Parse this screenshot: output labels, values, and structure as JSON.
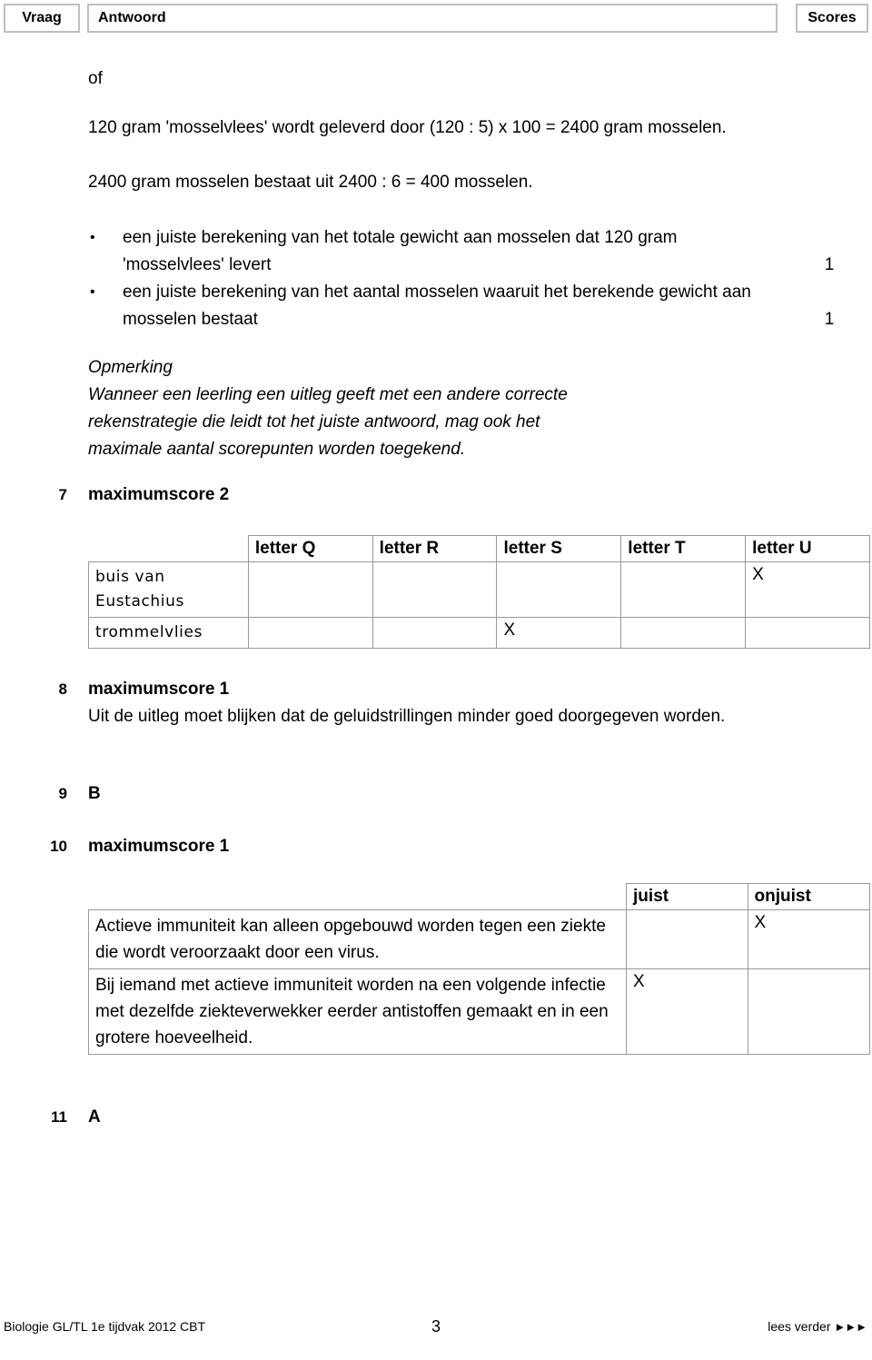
{
  "header": {
    "vraag": "Vraag",
    "antwoord": "Antwoord",
    "scores": "Scores"
  },
  "continued_answer": {
    "of_label": "of",
    "line1": "120 gram 'mosselvlees' wordt geleverd door (120 : 5) x 100 = 2400 gram mosselen.",
    "line2": "2400 gram mosselen bestaat uit 2400 : 6 = 400 mosselen.",
    "bullets": [
      {
        "text": "een juiste berekening van het totale gewicht aan mosselen dat 120 gram 'mosselvlees' levert",
        "score": "1"
      },
      {
        "text": "een juiste berekening van het aantal mosselen waaruit het berekende gewicht aan mosselen bestaat",
        "score": "1"
      }
    ],
    "note_title": "Opmerking",
    "note_body": "Wanneer een leerling een uitleg geeft met een andere correcte rekenstrategie die leidt tot het juiste antwoord, mag ook het maximale aantal scorepunten worden toegekend."
  },
  "questions": [
    {
      "number": "7",
      "heading": "maximumscore 2",
      "table": {
        "corner": "",
        "columns": [
          "letter Q",
          "letter R",
          "letter S",
          "letter T",
          "letter U"
        ],
        "rows": [
          {
            "label": "buis van Eustachius",
            "marks": [
              "",
              "",
              "",
              "",
              "X"
            ]
          },
          {
            "label": "trommelvlies",
            "marks": [
              "",
              "",
              "X",
              "",
              ""
            ]
          }
        ]
      }
    },
    {
      "number": "8",
      "heading": "maximumscore 1",
      "body": "Uit de uitleg moet blijken dat de geluidstrillingen minder goed doorgegeven worden."
    },
    {
      "number": "9",
      "heading": "B"
    },
    {
      "number": "10",
      "heading": "maximumscore 1",
      "table": {
        "corner": "",
        "columns": [
          "juist",
          "onjuist"
        ],
        "rows": [
          {
            "label": "Actieve immuniteit kan alleen opgebouwd worden tegen een ziekte die wordt veroorzaakt door een virus.",
            "marks": [
              "",
              "X"
            ]
          },
          {
            "label": "Bij iemand met actieve immuniteit worden na een volgende infectie met dezelfde ziekteverwekker eerder antistoffen gemaakt en in een grotere hoeveelheid.",
            "marks": [
              "X",
              ""
            ]
          }
        ]
      }
    },
    {
      "number": "11",
      "heading": "A"
    }
  ],
  "footer": {
    "left": "Biologie GL/TL 1e tijdvak 2012 CBT",
    "page": "3",
    "right": "lees verder",
    "arrows": "►►►"
  }
}
